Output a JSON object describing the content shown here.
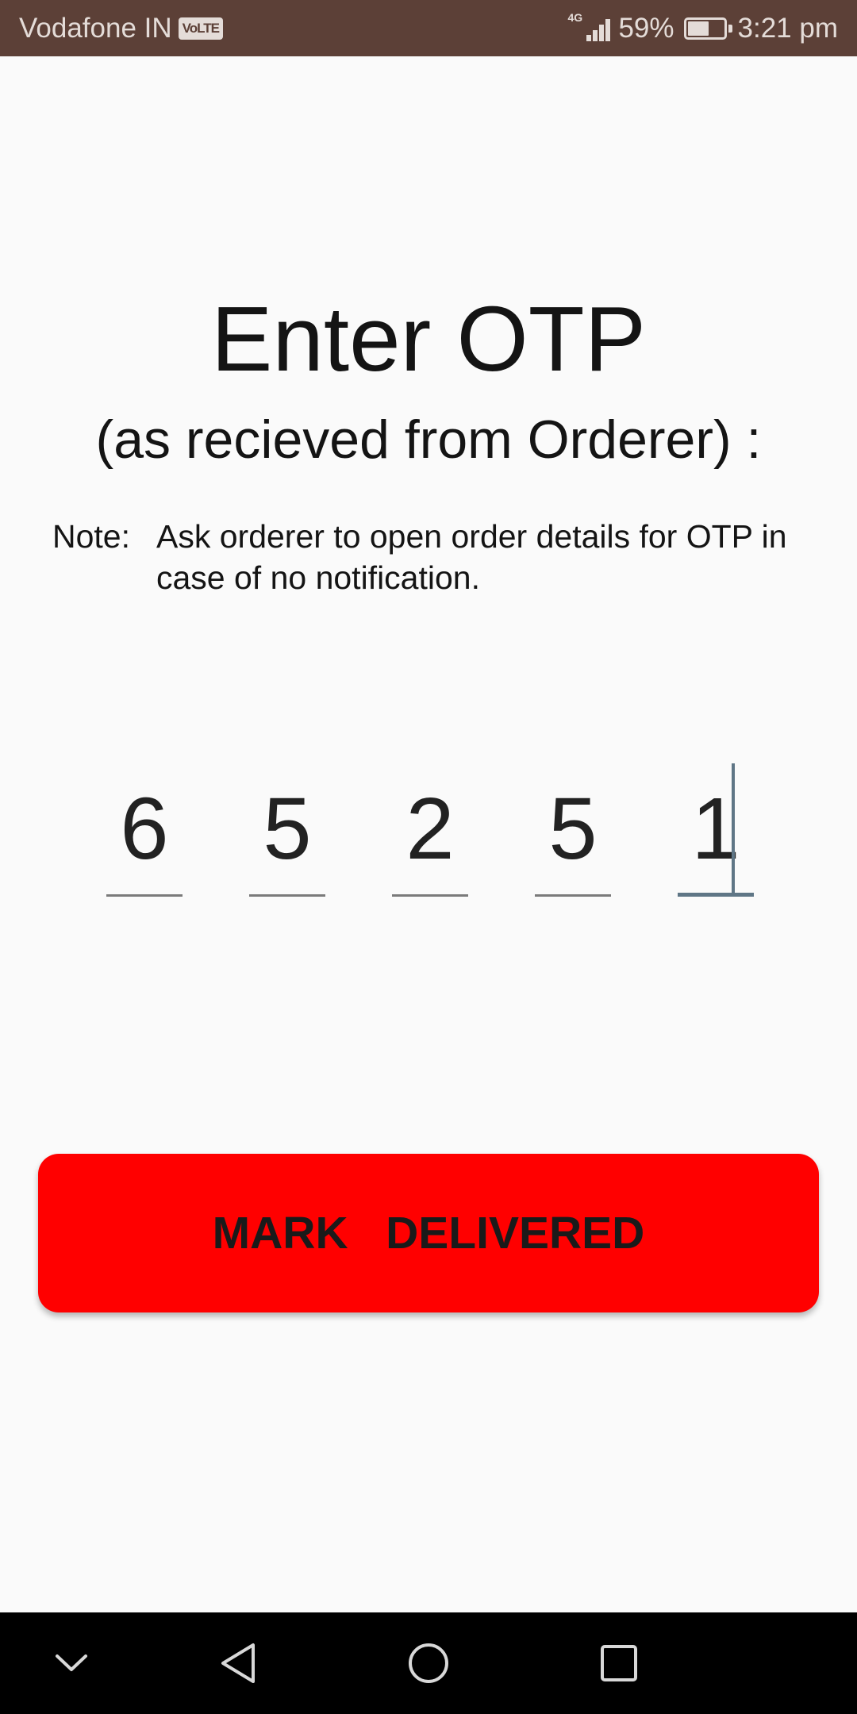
{
  "status_bar": {
    "carrier": "Vodafone IN",
    "volte_badge": "VoLTE",
    "network_type": "4G",
    "signal_icon": "signal-strength-icon",
    "battery_percent": "59%",
    "battery_icon": "battery-icon",
    "battery_level": 0.59,
    "time": "3:21 pm",
    "background_color": "#5c4037"
  },
  "screen": {
    "title": "Enter OTP",
    "subtitle": "(as recieved from Orderer) :",
    "note_label": "Note:",
    "note_text": "Ask orderer to open order details for OTP in case of no notification."
  },
  "otp": {
    "digits": [
      "6",
      "5",
      "2",
      "5",
      "1"
    ],
    "active_index": 4
  },
  "actions": {
    "mark_delivered_label": "MARK   DELIVERED",
    "button_color": "#ff0000"
  },
  "nav_bar": {
    "items": [
      {
        "icon": "chevron-down-icon"
      },
      {
        "icon": "back-triangle-icon"
      },
      {
        "icon": "home-circle-icon"
      },
      {
        "icon": "recents-square-icon"
      }
    ]
  }
}
